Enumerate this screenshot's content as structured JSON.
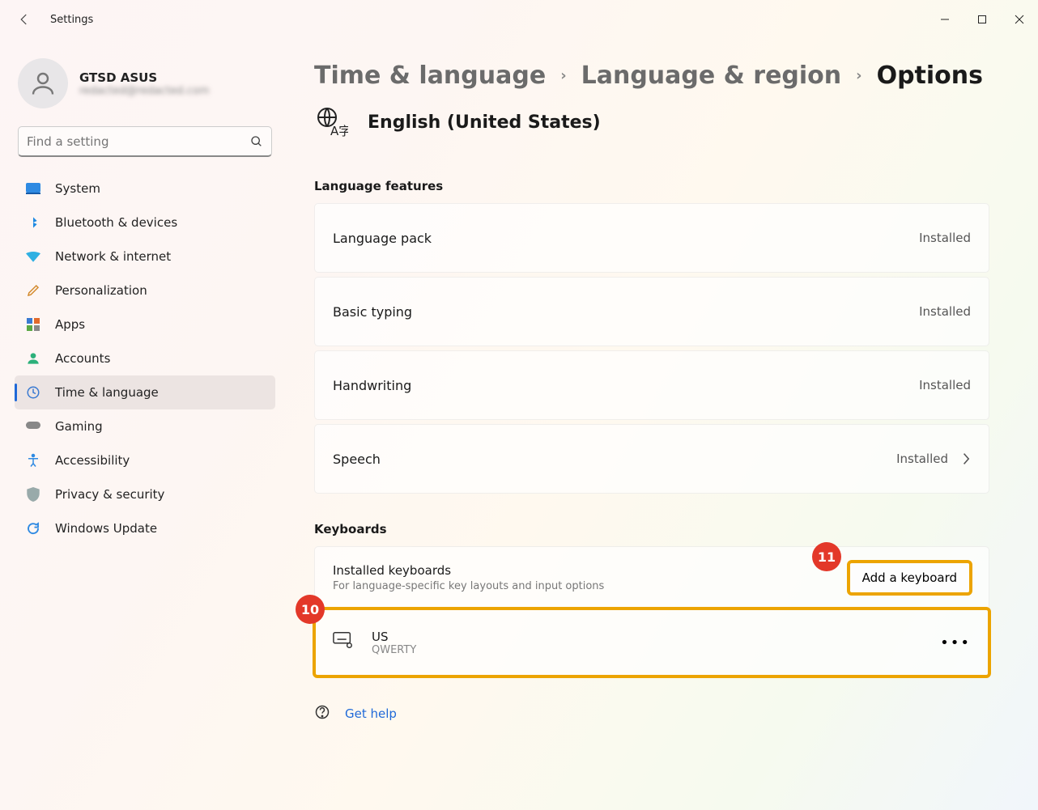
{
  "titlebar": {
    "app_name": "Settings"
  },
  "user": {
    "name": "GTSD ASUS",
    "sub": "redacted@redacted.com"
  },
  "search": {
    "placeholder": "Find a setting"
  },
  "nav": [
    {
      "label": "System"
    },
    {
      "label": "Bluetooth & devices"
    },
    {
      "label": "Network & internet"
    },
    {
      "label": "Personalization"
    },
    {
      "label": "Apps"
    },
    {
      "label": "Accounts"
    },
    {
      "label": "Time & language"
    },
    {
      "label": "Gaming"
    },
    {
      "label": "Accessibility"
    },
    {
      "label": "Privacy & security"
    },
    {
      "label": "Windows Update"
    }
  ],
  "breadcrumb": {
    "a": "Time & language",
    "b": "Language & region",
    "c": "Options"
  },
  "language": {
    "name": "English (United States)"
  },
  "sections": {
    "features_title": "Language features",
    "keyboards_title": "Keyboards"
  },
  "features": [
    {
      "label": "Language pack",
      "status": "Installed",
      "chevron": false
    },
    {
      "label": "Basic typing",
      "status": "Installed",
      "chevron": false
    },
    {
      "label": "Handwriting",
      "status": "Installed",
      "chevron": false
    },
    {
      "label": "Speech",
      "status": "Installed",
      "chevron": true
    }
  ],
  "keyboards": {
    "header_title": "Installed keyboards",
    "header_sub": "For language-specific key layouts and input options",
    "add_button": "Add a keyboard",
    "items": [
      {
        "name": "US",
        "layout": "QWERTY"
      }
    ]
  },
  "help": {
    "label": "Get help"
  },
  "callouts": {
    "a": "10",
    "b": "11"
  }
}
